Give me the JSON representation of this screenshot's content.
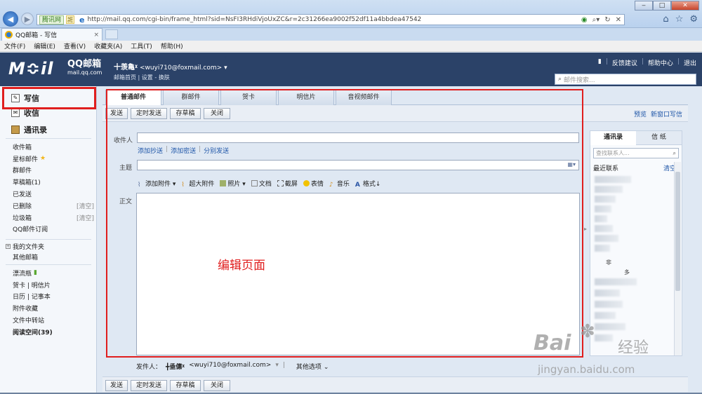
{
  "browser": {
    "back_icon": "back-arrow-icon",
    "address_chip": "腾讯网",
    "address_chip2": "誑",
    "url": "http://mail.qq.com/cgi-bin/frame_html?sid=NsFI3RHdiVjoUxZC&r=2c31266ea9002f52df11a4bbdea47542",
    "tab_title": "QQ邮箱 - 写信",
    "tab_close": "×",
    "window_min": "‒",
    "window_max": "□",
    "window_close": "✕"
  },
  "menubar": [
    "文件(F)",
    "编辑(E)",
    "查看(V)",
    "收藏夹(A)",
    "工具(T)",
    "帮助(H)"
  ],
  "header": {
    "logo_mark": "M≎il",
    "logo_name": "QQ邮箱",
    "logo_domain": "mail.qq.com",
    "user_name": "十羡亀ᵡ",
    "user_email": "<wuyi710@foxmail.com>",
    "user_dropdown": "▾",
    "links_line": "邮箱首页 | 设置 - 换肤",
    "top_links": [
      "反馈建议",
      "帮助中心",
      "退出"
    ],
    "search_placeholder": "邮件搜索..."
  },
  "sidebar": {
    "compose": "写信",
    "inbox": "收信",
    "contacts": "通讯录",
    "folders": [
      {
        "label": "收件箱",
        "extra": ""
      },
      {
        "label": "星标邮件",
        "extra": ""
      },
      {
        "label": "群邮件",
        "extra": ""
      },
      {
        "label": "草稿箱(1)",
        "extra": ""
      },
      {
        "label": "已发送",
        "extra": ""
      },
      {
        "label": "已删除",
        "extra": "[清空]"
      },
      {
        "label": "垃圾箱",
        "extra": "[清空]"
      },
      {
        "label": "QQ邮件订阅",
        "extra": ""
      }
    ],
    "my_folders": "我的文件夹",
    "other_mail": "其他邮箱",
    "apps": [
      "漂流瓶",
      "贺卡 | 明信片",
      "日历 | 记事本",
      "附件收藏",
      "文件中转站",
      "阅读空间(39)"
    ]
  },
  "compose": {
    "tabs": [
      "普通邮件",
      "群邮件",
      "贺卡",
      "明信片",
      "音视频邮件"
    ],
    "toolbar_buttons": [
      "发送",
      "定时发送",
      "存草稿",
      "关闭"
    ],
    "toolbar_links": [
      "预览",
      "新窗口写信"
    ],
    "to_label": "收件人",
    "cc_links": [
      "添加抄送",
      "添加密送",
      "分别发送"
    ],
    "subject_label": "主题",
    "attach_items": [
      "添加附件",
      "超大附件",
      "照片",
      "文档",
      "截屏",
      "表情",
      "音乐",
      "格式"
    ],
    "body_label": "正文",
    "editor_annotation": "编辑页面",
    "sender_label": "发件人：",
    "sender_name": "╋亟僡ᵡ",
    "sender_email": "<wuyi710@foxmail.com>",
    "sender_dropdown": "▾",
    "other_options": "其他选项"
  },
  "contacts_panel": {
    "tabs": [
      "通讯录",
      "信 纸"
    ],
    "search_placeholder": "查找联系人...",
    "recent": "最近联系",
    "clear": "清空",
    "partial_texts": [
      "非",
      "多"
    ]
  },
  "watermark": {
    "brand": "Bai",
    "brand_cn": "经验",
    "url": "jingyan.baidu.com"
  },
  "colors": {
    "header_bg": "#2b4268",
    "highlight": "#e01e1e",
    "link": "#1f56a8"
  }
}
